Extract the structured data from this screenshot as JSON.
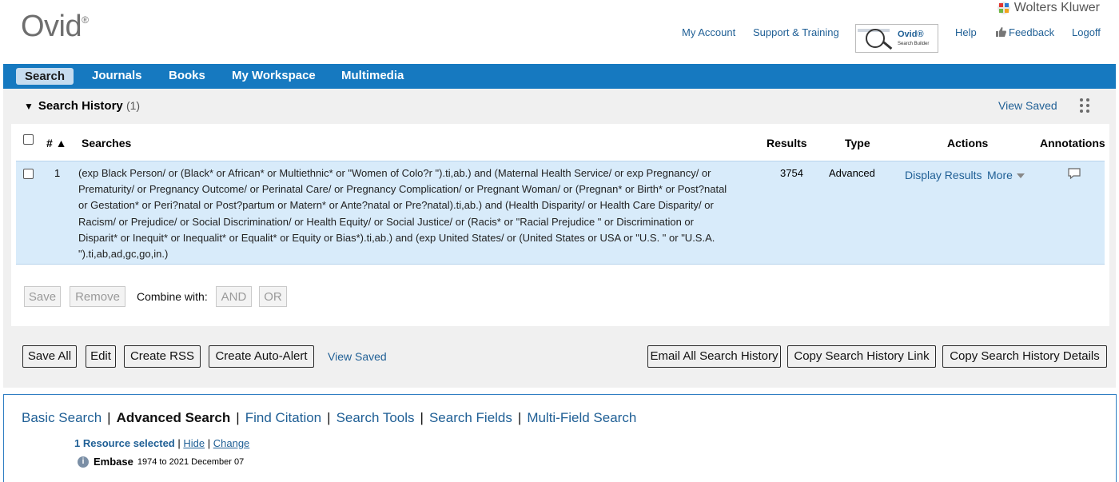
{
  "header": {
    "logo": "Ovid",
    "logo_mark": "®",
    "brand": "Wolters Kluwer",
    "links": {
      "my_account": "My Account",
      "support": "Support & Training",
      "help": "Help",
      "feedback": "Feedback",
      "logoff": "Logoff"
    },
    "search_builder": {
      "title": "Ovid®",
      "subtitle": "Search Builder"
    }
  },
  "nav": {
    "active": "Search",
    "items": [
      "Journals",
      "Books",
      "My Workspace",
      "Multimedia"
    ]
  },
  "history": {
    "title": "Search History",
    "count": "(1)",
    "view_saved": "View Saved",
    "columns": {
      "num": "# ▲",
      "searches": "Searches",
      "results": "Results",
      "type": "Type",
      "actions": "Actions",
      "annotations": "Annotations"
    },
    "rows": [
      {
        "num": "1",
        "query": "(exp Black Person/ or (Black* or African* or Multiethnic* or \"Women of Colo?r \").ti,ab.) and (Maternal Health Service/ or exp Pregnancy/ or Prematurity/ or Pregnancy Outcome/ or Perinatal Care/ or Pregnancy Complication/ or Pregnant Woman/ or (Pregnan* or Birth* or Post?natal or Gestation* or Peri?natal or Post?partum or Matern* or Ante?natal or Pre?natal).ti,ab.) and (Health Disparity/ or Health Care Disparity/ or Racism/ or Prejudice/ or Social Discrimination/ or Health Equity/ or Social Justice/ or (Racis* or \"Racial Prejudice \" or Discrimination or Disparit* or Inequit* or Inequalit* or Equalit* or Equity or Bias*).ti,ab.) and (exp United States/ or (United States or USA or \"U.S. \" or \"U.S.A. \").ti,ab,ad,gc,go,in.)",
        "results": "3754",
        "type": "Advanced",
        "display_results": "Display Results",
        "more": "More"
      }
    ],
    "save": "Save",
    "remove": "Remove",
    "combine_with": "Combine with:",
    "and": "AND",
    "or": "OR",
    "bottom_buttons": {
      "save_all": "Save All",
      "edit": "Edit",
      "create_rss": "Create RSS",
      "create_auto_alert": "Create Auto-Alert",
      "view_saved": "View Saved",
      "email_all": "Email All Search History",
      "copy_link": "Copy Search History Link",
      "copy_details": "Copy Search History Details"
    }
  },
  "search_tabs": {
    "tabs": [
      "Basic Search",
      "Advanced Search",
      "Find Citation",
      "Search Tools",
      "Search Fields",
      "Multi-Field Search"
    ],
    "active": "Advanced Search",
    "resource_selected": "1 Resource selected",
    "hide": "Hide",
    "change": "Change",
    "database": "Embase",
    "database_range": "1974 to 2021 December 07"
  }
}
